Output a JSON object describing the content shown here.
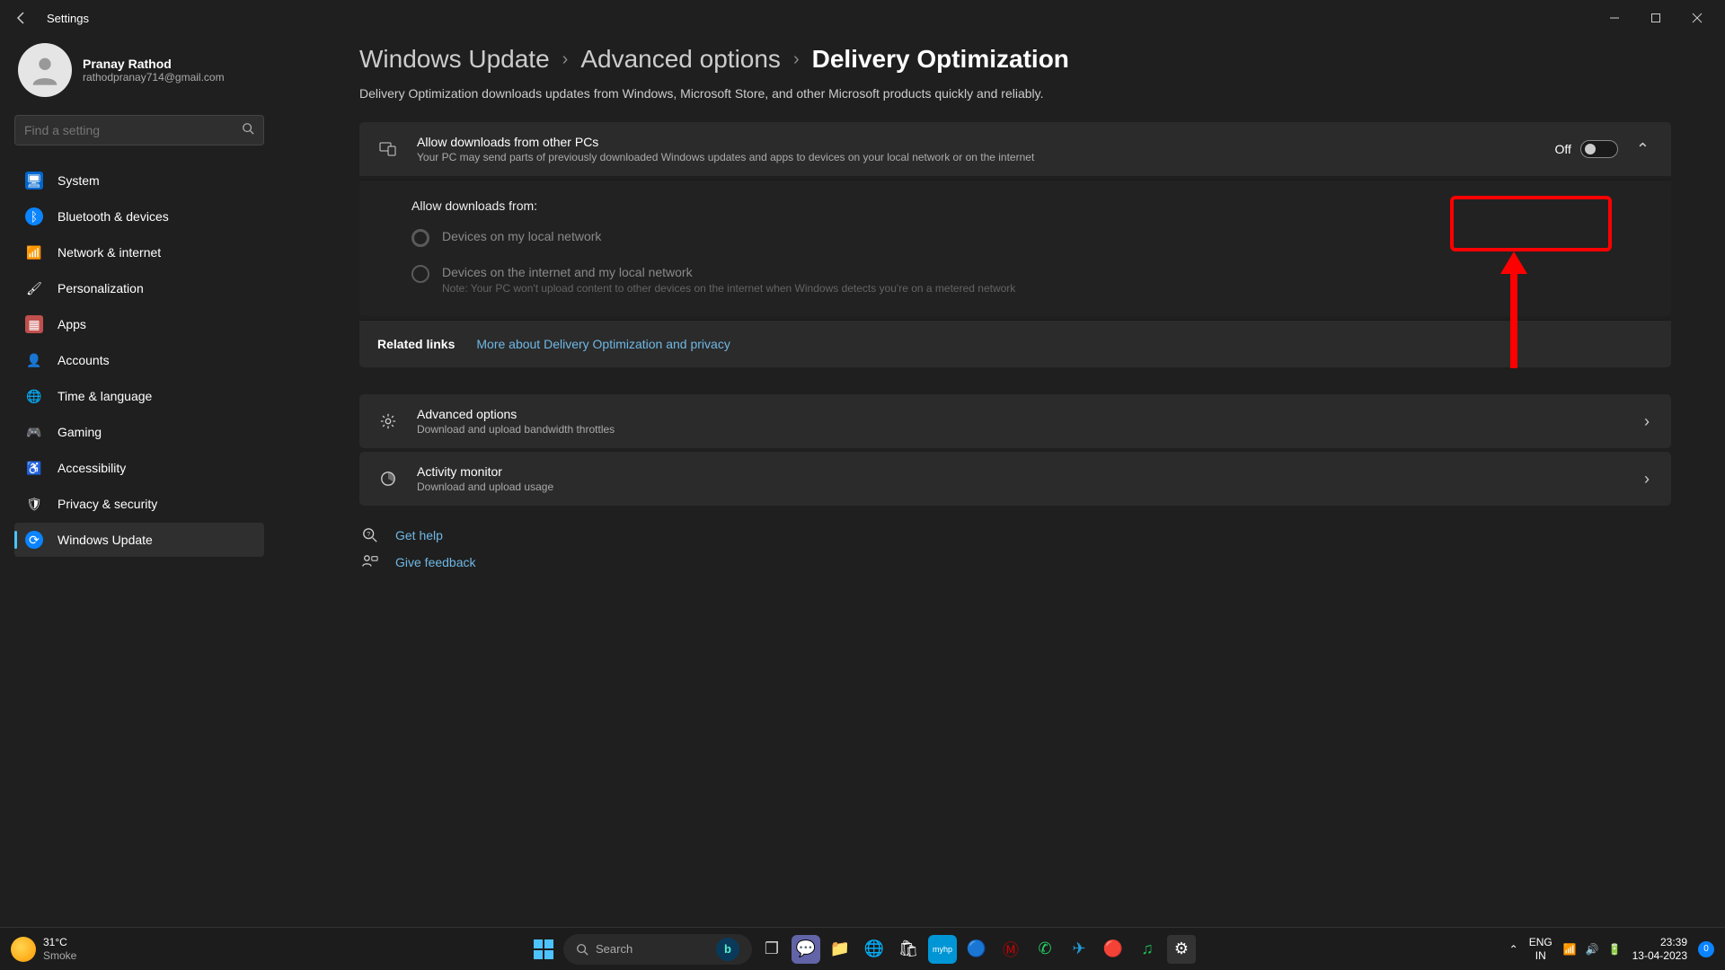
{
  "titlebar": {
    "title": "Settings"
  },
  "user": {
    "name": "Pranay Rathod",
    "email": "rathodpranay714@gmail.com"
  },
  "search": {
    "placeholder": "Find a setting"
  },
  "nav": [
    {
      "label": "System",
      "icon_bg": "#0066cc",
      "icon": "🖥"
    },
    {
      "label": "Bluetooth & devices",
      "icon_bg": "#0a84ff",
      "icon": "ᛒ",
      "round": true
    },
    {
      "label": "Network & internet",
      "icon_bg": "transparent",
      "icon": "📶"
    },
    {
      "label": "Personalization",
      "icon_bg": "transparent",
      "icon": "🖌"
    },
    {
      "label": "Apps",
      "icon_bg": "#c0504d",
      "icon": "▦"
    },
    {
      "label": "Accounts",
      "icon_bg": "transparent",
      "icon": "👤"
    },
    {
      "label": "Time & language",
      "icon_bg": "transparent",
      "icon": "🌐"
    },
    {
      "label": "Gaming",
      "icon_bg": "transparent",
      "icon": "🎮"
    },
    {
      "label": "Accessibility",
      "icon_bg": "transparent",
      "icon": "♿"
    },
    {
      "label": "Privacy & security",
      "icon_bg": "transparent",
      "icon": "🛡"
    },
    {
      "label": "Windows Update",
      "icon_bg": "#0a84ff",
      "icon": "⟳",
      "round": true,
      "active": true
    }
  ],
  "breadcrumb": {
    "a": "Windows Update",
    "b": "Advanced options",
    "c": "Delivery Optimization"
  },
  "description": "Delivery Optimization downloads updates from Windows, Microsoft Store, and other Microsoft products quickly and reliably.",
  "allowCard": {
    "title": "Allow downloads from other PCs",
    "sub": "Your PC may send parts of previously downloaded Windows updates and apps to devices on your local network or on the internet",
    "toggle": "Off"
  },
  "allowFrom": {
    "label": "Allow downloads from:",
    "opt1": "Devices on my local network",
    "opt2": "Devices on the internet and my local network",
    "opt2note": "Note: Your PC won't upload content to other devices on the internet when Windows detects you're on a metered network"
  },
  "related": {
    "label": "Related links",
    "link": "More about Delivery Optimization and privacy"
  },
  "advanced": {
    "title": "Advanced options",
    "sub": "Download and upload bandwidth throttles"
  },
  "activity": {
    "title": "Activity monitor",
    "sub": "Download and upload usage"
  },
  "help": {
    "get": "Get help",
    "feedback": "Give feedback"
  },
  "taskbar": {
    "weather_temp": "31°C",
    "weather_desc": "Smoke",
    "search": "Search",
    "lang1": "ENG",
    "lang2": "IN",
    "time": "23:39",
    "date": "13-04-2023",
    "notif": "0"
  }
}
